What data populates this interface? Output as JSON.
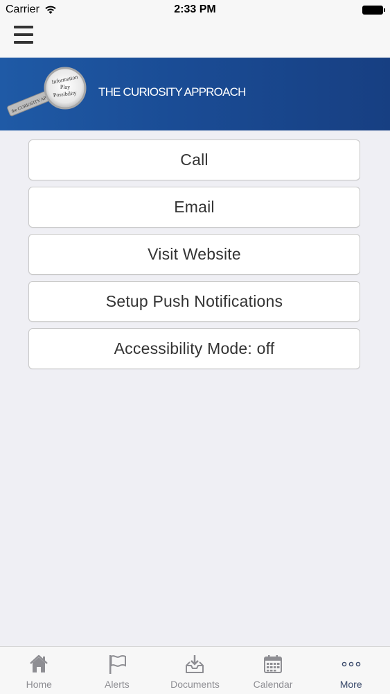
{
  "status_bar": {
    "carrier": "Carrier",
    "time": "2:33 PM"
  },
  "banner": {
    "title": "THE CURIOSITY APPROACH",
    "logo_text": [
      "Information",
      "Play",
      "Possibility"
    ],
    "logo_handle_text": "the CURIOSITY APPROACH",
    "colors": {
      "start": "#1f5aa6",
      "end": "#173f82"
    }
  },
  "menu": {
    "items": [
      {
        "label": "Call"
      },
      {
        "label": "Email"
      },
      {
        "label": "Visit Website"
      },
      {
        "label": "Setup Push Notifications"
      },
      {
        "label": "Accessibility Mode: off"
      }
    ]
  },
  "tabbar": {
    "tabs": [
      {
        "label": "Home",
        "icon": "home-icon"
      },
      {
        "label": "Alerts",
        "icon": "flag-icon"
      },
      {
        "label": "Documents",
        "icon": "inbox-download-icon"
      },
      {
        "label": "Calendar",
        "icon": "calendar-icon"
      },
      {
        "label": "More",
        "icon": "more-dots-icon",
        "active": true
      }
    ]
  }
}
